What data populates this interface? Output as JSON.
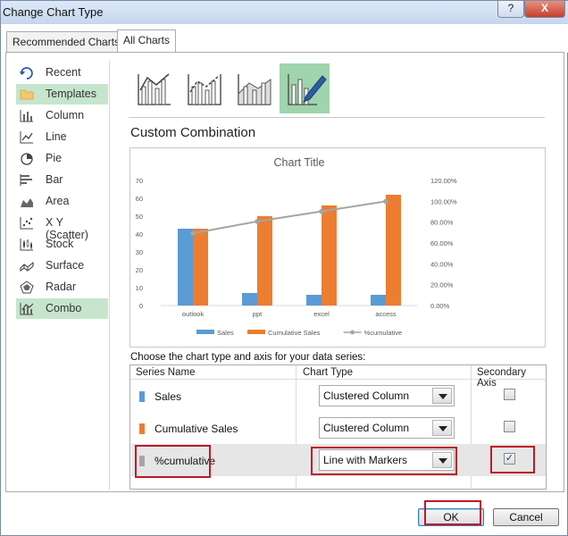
{
  "window": {
    "title": "Change Chart Type",
    "help_label": "?",
    "close_label": "X"
  },
  "tabs": [
    {
      "label": "Recommended Charts"
    },
    {
      "label": "All Charts"
    }
  ],
  "categories": [
    {
      "label": "Recent",
      "icon": "recent-icon"
    },
    {
      "label": "Templates",
      "icon": "templates-folder-icon"
    },
    {
      "label": "Column",
      "icon": "column-chart-icon"
    },
    {
      "label": "Line",
      "icon": "line-chart-icon"
    },
    {
      "label": "Pie",
      "icon": "pie-chart-icon"
    },
    {
      "label": "Bar",
      "icon": "bar-chart-icon"
    },
    {
      "label": "Area",
      "icon": "area-chart-icon"
    },
    {
      "label": "X Y (Scatter)",
      "icon": "scatter-chart-icon"
    },
    {
      "label": "Stock",
      "icon": "stock-chart-icon"
    },
    {
      "label": "Surface",
      "icon": "surface-chart-icon"
    },
    {
      "label": "Radar",
      "icon": "radar-chart-icon"
    },
    {
      "label": "Combo",
      "icon": "combo-chart-icon"
    }
  ],
  "selected_category": "Combo",
  "heading": "Custom Combination",
  "choose_label": "Choose the chart type and axis for your data series:",
  "grid": {
    "headers": {
      "series": "Series Name",
      "type": "Chart Type",
      "secondary": "Secondary Axis"
    },
    "rows": [
      {
        "name": "Sales",
        "type": "Clustered Column",
        "secondary": false,
        "color": "#5b9bd5"
      },
      {
        "name": "Cumulative Sales",
        "type": "Clustered Column",
        "secondary": false,
        "color": "#ed7d31"
      },
      {
        "name": "%cumulative",
        "type": "Line with Markers",
        "secondary": true,
        "color": "#a5a5a5"
      }
    ],
    "check_mark": "✓"
  },
  "buttons": {
    "ok": "OK",
    "cancel": "Cancel"
  },
  "chart_data": {
    "type": "bar",
    "title": "Chart Title",
    "categories": [
      "outlook",
      "ppt",
      "excel",
      "access"
    ],
    "series": [
      {
        "name": "Sales",
        "type": "bar",
        "axis": "primary",
        "color": "#5b9bd5",
        "values": [
          43,
          7,
          6,
          6
        ]
      },
      {
        "name": "Cumulative Sales",
        "type": "bar",
        "axis": "primary",
        "color": "#ed7d31",
        "values": [
          43,
          50,
          56,
          62
        ]
      },
      {
        "name": "%cumulative",
        "type": "line",
        "axis": "secondary",
        "color": "#a5a5a5",
        "values": [
          0.6935,
          0.8065,
          0.9032,
          1.0
        ]
      }
    ],
    "ylim": [
      0,
      70
    ],
    "y_ticks": [
      "0",
      "10",
      "20",
      "30",
      "40",
      "50",
      "60",
      "70"
    ],
    "y2lim": [
      0,
      1.2
    ],
    "y2_ticks": [
      "0.00%",
      "20.00%",
      "40.00%",
      "60.00%",
      "80.00%",
      "100.00%",
      "120.00%"
    ],
    "grid": false,
    "legend": "bottom"
  }
}
